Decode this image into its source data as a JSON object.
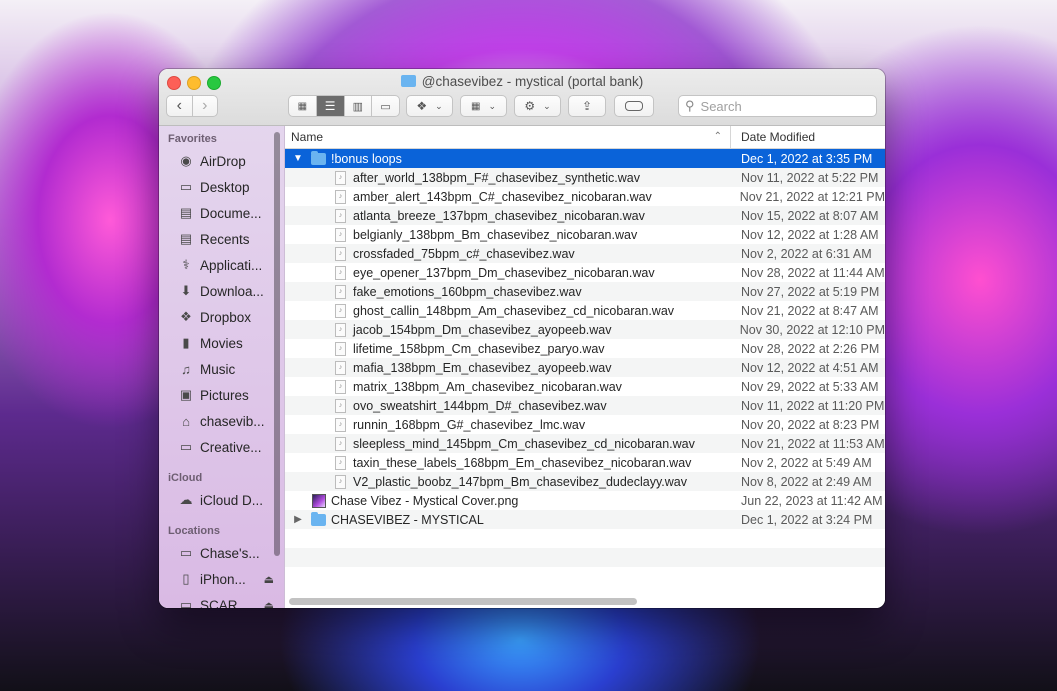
{
  "window": {
    "title": "@chasevibez - mystical (portal bank)"
  },
  "toolbar": {
    "search_placeholder": "Search"
  },
  "sidebar": {
    "sections": [
      {
        "title": "Favorites",
        "items": [
          {
            "label": "AirDrop",
            "icon": "airdrop-icon"
          },
          {
            "label": "Desktop",
            "icon": "desktop-icon"
          },
          {
            "label": "Docume...",
            "icon": "document-icon"
          },
          {
            "label": "Recents",
            "icon": "recents-icon"
          },
          {
            "label": "Applicati...",
            "icon": "applications-icon"
          },
          {
            "label": "Downloa...",
            "icon": "download-icon"
          },
          {
            "label": "Dropbox",
            "icon": "dropbox-icon"
          },
          {
            "label": "Movies",
            "icon": "movies-icon"
          },
          {
            "label": "Music",
            "icon": "music-icon"
          },
          {
            "label": "Pictures",
            "icon": "pictures-icon"
          },
          {
            "label": "chasevib...",
            "icon": "home-icon"
          },
          {
            "label": "Creative...",
            "icon": "folder-icon"
          }
        ]
      },
      {
        "title": "iCloud",
        "items": [
          {
            "label": "iCloud D...",
            "icon": "icloud-icon"
          }
        ]
      },
      {
        "title": "Locations",
        "items": [
          {
            "label": "Chase's...",
            "icon": "laptop-icon"
          },
          {
            "label": "iPhon...",
            "icon": "iphone-icon"
          },
          {
            "label": "SCAR...",
            "icon": "disk-icon"
          }
        ]
      }
    ]
  },
  "columns": {
    "name": "Name",
    "date": "Date Modified"
  },
  "files": [
    {
      "name": "!bonus loops",
      "date": "Dec 1, 2022 at 3:35 PM",
      "kind": "folder",
      "expanded": true,
      "selected": true
    },
    {
      "name": "after_world_138bpm_F#_chasevibez_synthetic.wav",
      "date": "Nov 11, 2022 at 5:22 PM",
      "kind": "wav"
    },
    {
      "name": "amber_alert_143bpm_C#_chasevibez_nicobaran.wav",
      "date": "Nov 21, 2022 at 12:21 PM",
      "kind": "wav"
    },
    {
      "name": "atlanta_breeze_137bpm_chasevibez_nicobaran.wav",
      "date": "Nov 15, 2022 at 8:07 AM",
      "kind": "wav"
    },
    {
      "name": "belgianly_138bpm_Bm_chasevibez_nicobaran.wav",
      "date": "Nov 12, 2022 at 1:28 AM",
      "kind": "wav"
    },
    {
      "name": "crossfaded_75bpm_c#_chasevibez.wav",
      "date": "Nov 2, 2022 at 6:31 AM",
      "kind": "wav"
    },
    {
      "name": "eye_opener_137bpm_Dm_chasevibez_nicobaran.wav",
      "date": "Nov 28, 2022 at 11:44 AM",
      "kind": "wav"
    },
    {
      "name": "fake_emotions_160bpm_chasevibez.wav",
      "date": "Nov 27, 2022 at 5:19 PM",
      "kind": "wav"
    },
    {
      "name": "ghost_callin_148bpm_Am_chasevibez_cd_nicobaran.wav",
      "date": "Nov 21, 2022 at 8:47 AM",
      "kind": "wav"
    },
    {
      "name": "jacob_154bpm_Dm_chasevibez_ayopeeb.wav",
      "date": "Nov 30, 2022 at 12:10 PM",
      "kind": "wav"
    },
    {
      "name": "lifetime_158bpm_Cm_chasevibez_paryo.wav",
      "date": "Nov 28, 2022 at 2:26 PM",
      "kind": "wav"
    },
    {
      "name": "mafia_138bpm_Em_chasevibez_ayopeeb.wav",
      "date": "Nov 12, 2022 at 4:51 AM",
      "kind": "wav"
    },
    {
      "name": "matrix_138bpm_Am_chasevibez_nicobaran.wav",
      "date": "Nov 29, 2022 at 5:33 AM",
      "kind": "wav"
    },
    {
      "name": "ovo_sweatshirt_144bpm_D#_chasevibez.wav",
      "date": "Nov 11, 2022 at 11:20 PM",
      "kind": "wav"
    },
    {
      "name": "runnin_168bpm_G#_chasevibez_lmc.wav",
      "date": "Nov 20, 2022 at 8:23 PM",
      "kind": "wav"
    },
    {
      "name": "sleepless_mind_145bpm_Cm_chasevibez_cd_nicobaran.wav",
      "date": "Nov 21, 2022 at 11:53 AM",
      "kind": "wav"
    },
    {
      "name": "taxin_these_labels_168bpm_Em_chasevibez_nicobaran.wav",
      "date": "Nov 2, 2022 at 5:49 AM",
      "kind": "wav"
    },
    {
      "name": "V2_plastic_boobz_147bpm_Bm_chasevibez_dudeclayy.wav",
      "date": "Nov 8, 2022 at 2:49 AM",
      "kind": "wav"
    },
    {
      "name": "Chase Vibez - Mystical Cover.png",
      "date": "Jun 22, 2023 at 11:42 AM",
      "kind": "png"
    },
    {
      "name": "CHASEVIBEZ - MYSTICAL",
      "date": "Dec 1, 2022 at 3:24 PM",
      "kind": "folder",
      "expanded": false
    }
  ],
  "colors": {
    "selection": "#0a63d9",
    "folder": "#6ab4f0"
  }
}
